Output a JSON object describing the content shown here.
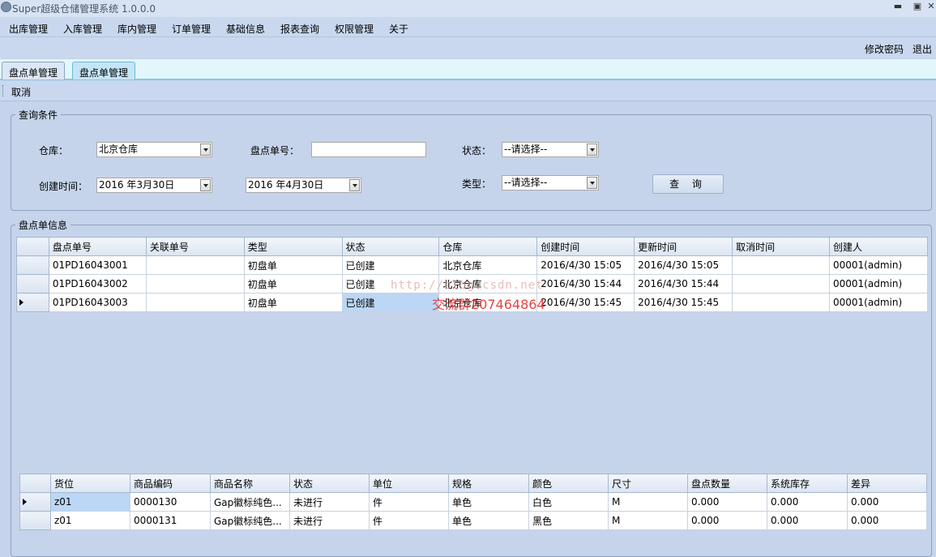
{
  "window": {
    "title": "Super超级仓储管理系统 1.0.0.0",
    "minimize": "▬",
    "restore": "▣",
    "close": "✕"
  },
  "menu": [
    "出库管理",
    "入库管理",
    "库内管理",
    "订单管理",
    "基础信息",
    "报表查询",
    "权限管理",
    "关于"
  ],
  "top_links": {
    "change_password": "修改密码",
    "logout": "退出"
  },
  "tabs": [
    "盘点单管理",
    "盘点单管理"
  ],
  "subtoolbar": {
    "cancel": "取消"
  },
  "query": {
    "group_title": "查询条件",
    "warehouse_label": "仓库：",
    "warehouse_value": "北京仓库",
    "order_no_label": "盘点单号：",
    "order_no_value": "",
    "status_label": "状态：",
    "status_value": "--请选择--",
    "created_label": "创建时间：",
    "date_from": "2016 年3月30日",
    "date_to": "2016 年4月30日",
    "type_label": "类型：",
    "type_value": "--请选择--",
    "query_button": "查 询"
  },
  "orders": {
    "group_title": "盘点单信息",
    "columns": [
      "盘点单号",
      "关联单号",
      "类型",
      "状态",
      "仓库",
      "创建时间",
      "更新时间",
      "取消时间",
      "创建人"
    ],
    "rows": [
      [
        "01PD16043001",
        "",
        "初盘单",
        "已创建",
        "北京仓库",
        "2016/4/30 15:05",
        "2016/4/30 15:05",
        "",
        "00001(admin)"
      ],
      [
        "01PD16043002",
        "",
        "初盘单",
        "已创建",
        "北京仓库",
        "2016/4/30 15:44",
        "2016/4/30 15:44",
        "",
        "00001(admin)"
      ],
      [
        "01PD16043003",
        "",
        "初盘单",
        "已创建",
        "北京仓库",
        "2016/4/30 15:45",
        "2016/4/30 15:45",
        "",
        "00001(admin)"
      ]
    ]
  },
  "details": {
    "columns": [
      "货位",
      "商品编码",
      "商品名称",
      "状态",
      "单位",
      "规格",
      "颜色",
      "尺寸",
      "盘点数量",
      "系统库存",
      "差异"
    ],
    "rows": [
      [
        "z01",
        "0000130",
        "Gap徽标纯色...",
        "未进行",
        "件",
        "单色",
        "白色",
        "M",
        "0.000",
        "0.000",
        "0.000"
      ],
      [
        "z01",
        "0000131",
        "Gap徽标纯色...",
        "未进行",
        "件",
        "单色",
        "黑色",
        "M",
        "0.000",
        "0.000",
        "0.000"
      ]
    ]
  },
  "watermark": {
    "url": "http://blog.csdn.net",
    "text": "交流群207464864"
  }
}
